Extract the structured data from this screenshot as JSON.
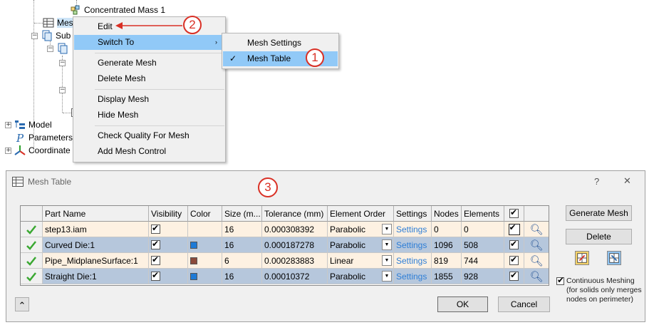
{
  "tree": {
    "items": [
      {
        "label": "Concentrated Mass 1",
        "icon": "mass-icon"
      },
      {
        "label": "Mes",
        "icon": "mesh-table-icon"
      },
      {
        "label": "Sub",
        "icon": "subassembly-icon"
      },
      {
        "label": "Model",
        "icon": "model-icon"
      },
      {
        "label": "Parameters",
        "icon": "parameters-icon"
      },
      {
        "label": "Coordinate",
        "icon": "coordinate-icon"
      }
    ]
  },
  "context_menu": {
    "items": [
      {
        "label": "Edit"
      },
      {
        "label": "Switch To",
        "highlighted": true
      },
      {
        "label": "Generate Mesh"
      },
      {
        "label": "Delete Mesh"
      },
      {
        "label": "Display Mesh"
      },
      {
        "label": "Hide Mesh"
      },
      {
        "label": "Check Quality For Mesh"
      },
      {
        "label": "Add Mesh Control"
      }
    ],
    "submenu_arrow": "›"
  },
  "submenu": {
    "items": [
      {
        "label": "Mesh Settings"
      },
      {
        "label": "Mesh Table",
        "checked": true,
        "highlighted": true
      }
    ],
    "check": "✓"
  },
  "callouts": [
    "2",
    "1",
    "3"
  ],
  "dialog": {
    "title": "Mesh Table",
    "help": "?",
    "close": "✕",
    "columns": [
      "Part Name",
      "Visibility",
      "Color",
      "Size (m...",
      "Tolerance (mm)",
      "Element Order",
      "Settings",
      "Nodes",
      "Elements"
    ],
    "rows": [
      {
        "part": "step13.iam",
        "visible": true,
        "color": "",
        "size": "16",
        "tolerance": "0.000308392",
        "order": "Parabolic",
        "settings": "Settings",
        "nodes": "0",
        "elements": "0"
      },
      {
        "part": "Curved Die:1",
        "visible": true,
        "color": "#1e7ad6",
        "size": "16",
        "tolerance": "0.000187278",
        "order": "Parabolic",
        "settings": "Settings",
        "nodes": "1096",
        "elements": "508"
      },
      {
        "part": "Pipe_MidplaneSurface:1",
        "visible": true,
        "color": "#8b4a3a",
        "size": "6",
        "tolerance": "0.000283883",
        "order": "Linear",
        "settings": "Settings",
        "nodes": "819",
        "elements": "744"
      },
      {
        "part": "Straight Die:1",
        "visible": true,
        "color": "#1e7ad6",
        "size": "16",
        "tolerance": "0.00010372",
        "order": "Parabolic",
        "settings": "Settings",
        "nodes": "1855",
        "elements": "928"
      }
    ],
    "buttons": {
      "generate": "Generate Mesh",
      "delete": "Delete",
      "ok": "OK",
      "cancel": "Cancel",
      "collapse": "⌃"
    },
    "continuous_meshing": {
      "checked": true,
      "line1": "Continuous Meshing",
      "line2": "(for solids only merges",
      "line3": "nodes on perimeter)"
    }
  },
  "colors": {
    "highlight": "#91c9f7",
    "callout": "#d93025",
    "row_light": "#fdf1e2",
    "row_blue": "#b6c7dc",
    "link": "#2e7ed6",
    "status_ok": "#3aa832"
  }
}
